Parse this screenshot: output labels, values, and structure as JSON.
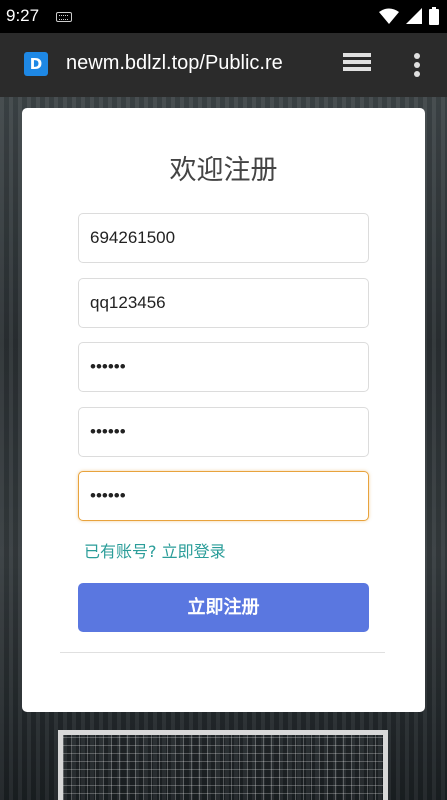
{
  "status_bar": {
    "time": "9:27"
  },
  "browser": {
    "url": "newm.bdlzl.top/Public.re",
    "site_icon_letter": "D"
  },
  "form": {
    "title": "欢迎注册",
    "fields": [
      {
        "value": "694261500"
      },
      {
        "value": "qq123456"
      },
      {
        "value": "••••••"
      },
      {
        "value": "••••••"
      },
      {
        "value": "••••••"
      }
    ],
    "login_link": "已有账号? 立即登录",
    "submit_label": "立即注册"
  },
  "colors": {
    "accent": "#5a77e0",
    "link": "#2a9d99",
    "focus_border": "#e8a33d"
  }
}
